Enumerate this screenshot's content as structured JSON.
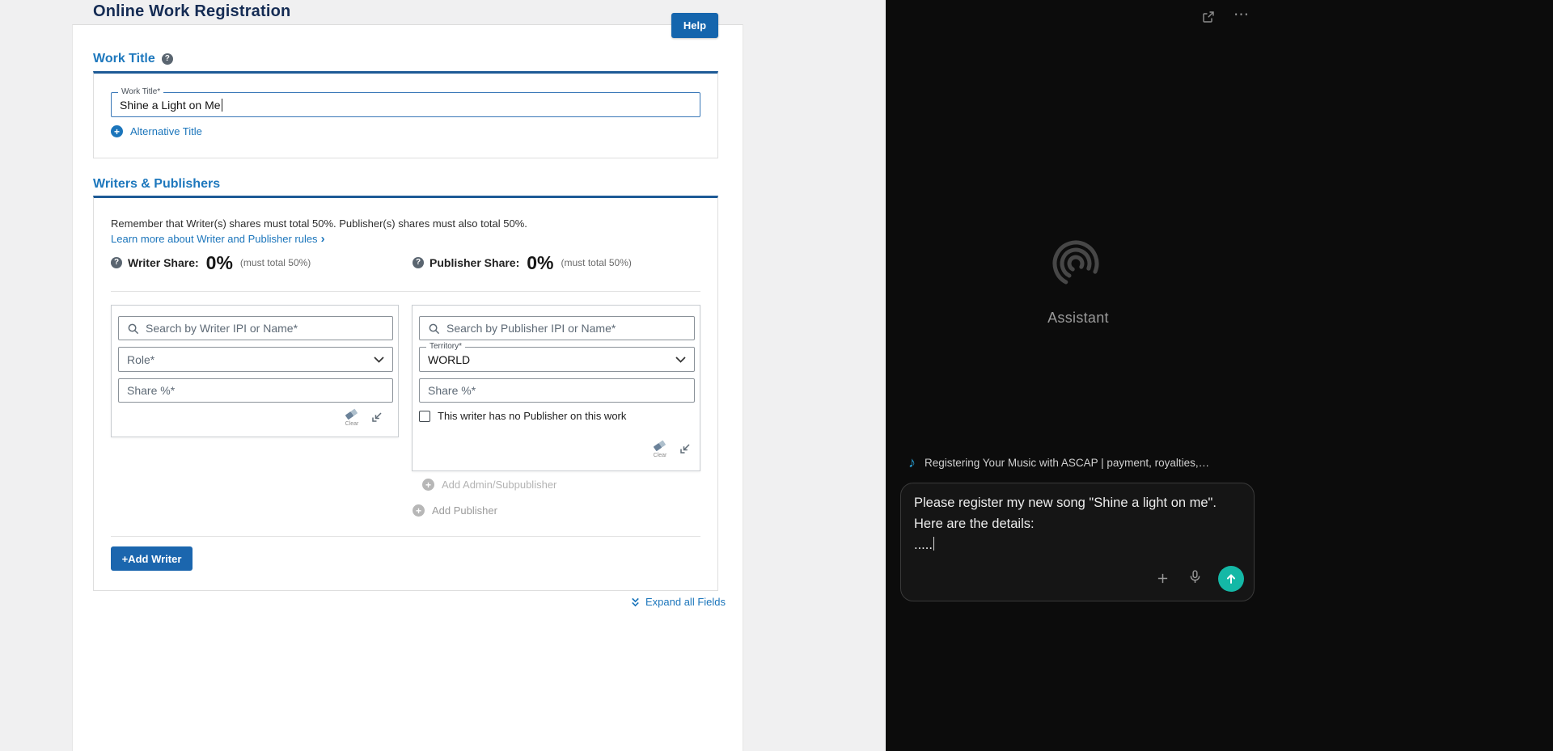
{
  "colors": {
    "accent_blue": "#1b75bb",
    "dark_navy": "#152c54",
    "help_button_blue": "#1565ad",
    "section_rule_blue": "#1d5a96",
    "send_teal": "#14b8a6",
    "assistant_bg": "#0c0c0c"
  },
  "icons": {
    "question": "?",
    "plus": "+",
    "chevron_right": "›",
    "ellipsis": "⋯",
    "music_note": "♪"
  },
  "form": {
    "title": "Online Work Registration",
    "help_button": "Help",
    "work_title": {
      "heading": "Work Title",
      "label": "Work Title*",
      "value": "Shine a Light on Me",
      "alt_title_link": "Alternative Title"
    },
    "writers_publishers": {
      "heading": "Writers & Publishers",
      "reminder": "Remember that Writer(s) shares must total 50%. Publisher(s) shares must also total 50%.",
      "learn_more": "Learn more about Writer and Publisher rules",
      "writer_share": {
        "label": "Writer Share:",
        "value": "0%",
        "note": "(must total 50%)"
      },
      "publisher_share": {
        "label": "Publisher Share:",
        "value": "0%",
        "note": "(must total 50%)"
      },
      "writer_card": {
        "search_placeholder": "Search by Writer IPI or Name*",
        "role_placeholder": "Role*",
        "share_placeholder": "Share %*",
        "clear": "Clear"
      },
      "publisher_card": {
        "search_placeholder": "Search by Publisher IPI or Name*",
        "territory_label": "Territory*",
        "territory_value": "WORLD",
        "share_placeholder": "Share %*",
        "no_publisher_label": "This writer has no Publisher on this work",
        "clear": "Clear"
      },
      "add_admin": "Add Admin/Subpublisher",
      "add_publisher": "Add Publisher",
      "add_writer": "+Add Writer"
    },
    "expand_all": "Expand all Fields"
  },
  "assistant": {
    "name": "Assistant",
    "history_title": "Registering Your Music with ASCAP | payment, royalties,…",
    "input": {
      "line1": "Please register my new song \"Shine a light on me\".",
      "line2": "Here are the details:",
      "line3": "....."
    }
  }
}
